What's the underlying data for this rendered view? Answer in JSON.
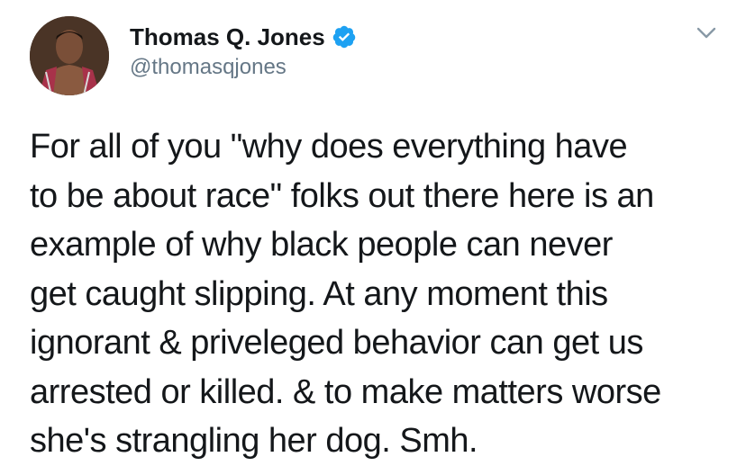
{
  "author": {
    "display_name": "Thomas Q. Jones",
    "handle": "@thomasqjones",
    "verified_icon": "verified-badge-icon",
    "avatar_icon": "profile-photo"
  },
  "menu": {
    "icon": "chevron-down-icon"
  },
  "tweet": {
    "lines": [
      "For all of you \"why does everything have",
      "to be about race\" folks out there here is an",
      "example of why black people can never",
      "get caught slipping. At any moment this",
      "ignorant & priveleged behavior can get us",
      "arrested or killed. & to make matters worse",
      "she's strangling her dog. Smh."
    ]
  },
  "colors": {
    "text": "#14171a",
    "secondary": "#657786",
    "verified": "#1da1f2",
    "chevron": "#8899a6"
  }
}
